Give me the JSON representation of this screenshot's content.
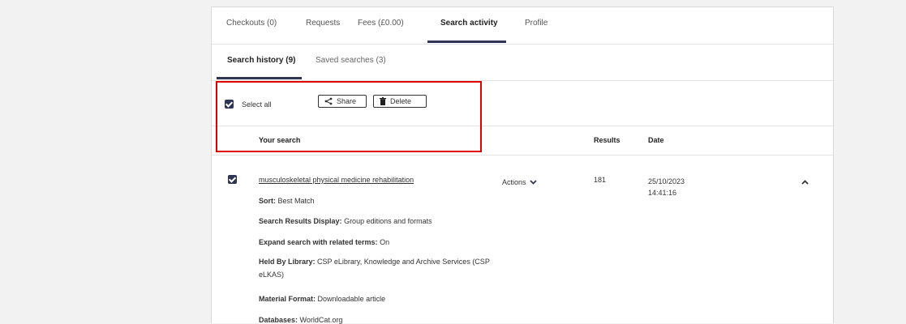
{
  "tabs": [
    {
      "label": "Checkouts (0)"
    },
    {
      "label": "Requests"
    },
    {
      "label": "Fees (£0.00)"
    },
    {
      "label": "Search activity"
    },
    {
      "label": "Profile"
    }
  ],
  "subtabs": [
    {
      "label": "Search history (9)"
    },
    {
      "label": "Saved searches (3)"
    }
  ],
  "toolbar": {
    "select_all_label": "Select all",
    "share_label": "Share",
    "delete_label": "Delete"
  },
  "columns": {
    "your_search": "Your search",
    "results": "Results",
    "date": "Date"
  },
  "search_item": {
    "query": "musculoskeletal physical medicine rehabilitation",
    "actions_label": "Actions",
    "results": "181",
    "date_line1": "25/10/2023",
    "date_line2": "14:41:16",
    "details": [
      {
        "key": "Sort:",
        "value": "Best Match"
      },
      {
        "key": "Search Results Display:",
        "value": "Group editions and formats"
      },
      {
        "key": "Expand search with related terms:",
        "value": "On"
      },
      {
        "key": "Held By Library:",
        "value": "CSP eLibrary, Knowledge and Archive Services (CSP eLKAS)"
      },
      {
        "key": "Material Format:",
        "value": "Downloadable article"
      },
      {
        "key": "Databases:",
        "value": "WorldCat.org"
      }
    ]
  },
  "colors": {
    "accent": "#2f3655",
    "highlight": "#e10000"
  },
  "icons": [
    "share-icon",
    "trash-icon",
    "chevron-down-icon",
    "chevron-up-icon",
    "checkbox-checked-icon"
  ]
}
